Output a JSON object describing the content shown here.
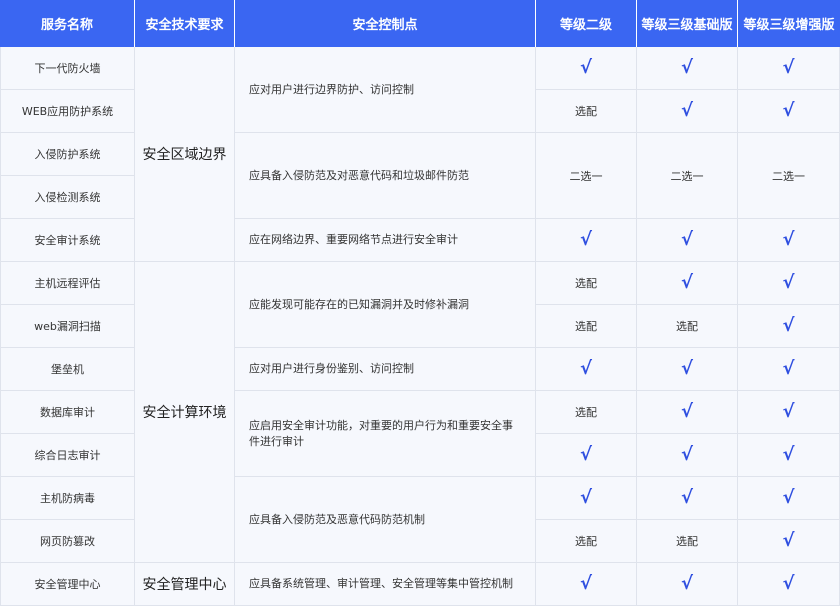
{
  "headers": {
    "service": "服务名称",
    "requirement": "安全技术要求",
    "control": "安全控制点",
    "level2": "等级二级",
    "level3_basic": "等级三级基础版",
    "level3_plus": "等级三级增强版"
  },
  "symbols": {
    "check": "√",
    "optional": "选配",
    "either": "二选一"
  },
  "rows": [
    {
      "service": "下一代防火墙",
      "level2": "√",
      "level3_basic": "√",
      "level3_plus": "√"
    },
    {
      "service": "WEB应用防护系统",
      "level2": "选配",
      "level3_basic": "√",
      "level3_plus": "√"
    },
    {
      "service": "入侵防护系统",
      "level2": "二选一",
      "level3_basic": "二选一",
      "level3_plus": "二选一"
    },
    {
      "service": "入侵检测系统"
    },
    {
      "service": "安全审计系统",
      "level2": "√",
      "level3_basic": "√",
      "level3_plus": "√"
    },
    {
      "service": "主机远程评估",
      "level2": "选配",
      "level3_basic": "√",
      "level3_plus": "√"
    },
    {
      "service": "web漏洞扫描",
      "level2": "选配",
      "level3_basic": "选配",
      "level3_plus": "√"
    },
    {
      "service": "堡垒机",
      "level2": "√",
      "level3_basic": "√",
      "level3_plus": "√"
    },
    {
      "service": "数据库审计",
      "level2": "选配",
      "level3_basic": "√",
      "level3_plus": "√"
    },
    {
      "service": "综合日志审计",
      "level2": "√",
      "level3_basic": "√",
      "level3_plus": "√"
    },
    {
      "service": "主机防病毒",
      "level2": "√",
      "level3_basic": "√",
      "level3_plus": "√"
    },
    {
      "service": "网页防篡改",
      "level2": "选配",
      "level3_basic": "选配",
      "level3_plus": "√"
    },
    {
      "service": "安全管理中心",
      "level2": "√",
      "level3_basic": "√",
      "level3_plus": "√"
    }
  ],
  "requirements": [
    {
      "label": "安全区域边界",
      "span": 5
    },
    {
      "label": "安全计算环境",
      "span": 7
    },
    {
      "label": "安全管理中心",
      "span": 1
    }
  ],
  "controls": [
    {
      "text": "应对用户进行边界防护、访问控制",
      "span": 2
    },
    {
      "text": "应具备入侵防范及对恶意代码和垃圾邮件防范",
      "span": 2
    },
    {
      "text": "应在网络边界、重要网络节点进行安全审计",
      "span": 1
    },
    {
      "text": "应能发现可能存在的已知漏洞并及时修补漏洞",
      "span": 2
    },
    {
      "text": "应对用户进行身份鉴别、访问控制",
      "span": 1
    },
    {
      "text": "应启用安全审计功能，对重要的用户行为和重要安全事件进行审计",
      "span": 2
    },
    {
      "text": "应具备入侵防范及恶意代码防范机制",
      "span": 2
    },
    {
      "text": "应具备系统管理、审计管理、安全管理等集中管控机制",
      "span": 1
    }
  ]
}
